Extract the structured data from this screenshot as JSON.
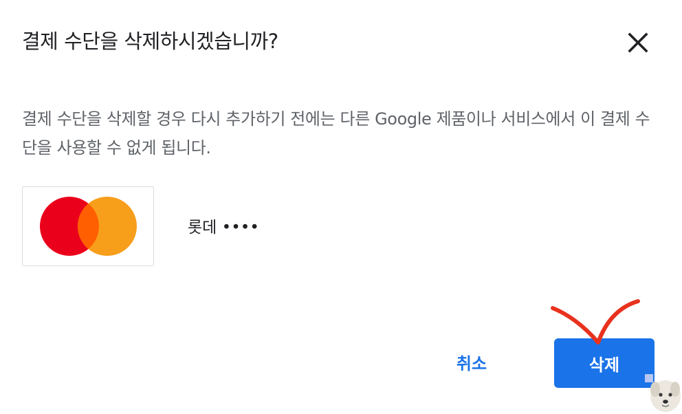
{
  "dialog": {
    "title": "결제 수단을 삭제하시겠습니까?",
    "description": "결제 수단을 삭제할 경우 다시 추가하기 전에는 다른 Google 제품이나 서비스에서 이 결제 수단을 사용할 수 없게 됩니다.",
    "close_icon": "close-icon"
  },
  "card": {
    "brand_logo": "mastercard-logo",
    "label": "롯데 ••••"
  },
  "actions": {
    "cancel_label": "취소",
    "delete_label": "삭제"
  },
  "colors": {
    "primary": "#1a73e8",
    "title_text": "#202124",
    "body_text": "#5f6368",
    "annotation": "#e8321e",
    "mastercard_red": "#eb001b",
    "mastercard_orange": "#f79e1b",
    "mastercard_overlap": "#ff5f00"
  }
}
